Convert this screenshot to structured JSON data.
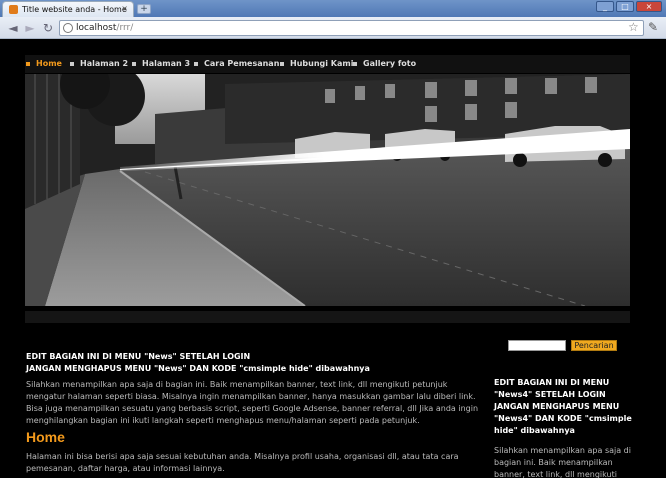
{
  "browser": {
    "tab_title": "Title website anda - Home",
    "tab_close": "×",
    "new_tab": "+",
    "url_host": "localhost",
    "url_path": "/rrr/",
    "win_min": "_",
    "win_max": "□",
    "win_close": "×",
    "icons": {
      "back": "◄",
      "forward": "►",
      "reload": "↻",
      "star": "☆",
      "wrench": "✎"
    }
  },
  "menu": {
    "items": [
      {
        "label": "Home",
        "active": true
      },
      {
        "label": "Halaman 2",
        "active": false
      },
      {
        "label": "Halaman 3",
        "active": false
      },
      {
        "label": "Cara Pemesanan",
        "active": false
      },
      {
        "label": "Hubungi Kami",
        "active": false
      },
      {
        "label": "Gallery foto",
        "active": false
      }
    ]
  },
  "search": {
    "placeholder": "",
    "button_label": "Pencarian"
  },
  "main": {
    "notice_line1": "EDIT BAGIAN INI DI MENU \"News\" SETELAH LOGIN",
    "notice_line2": "JANGAN MENGHAPUS MENU \"News\" DAN KODE \"cmsimple hide\" dibawahnya",
    "intro": "Silahkan menampilkan apa saja di bagian ini. Baik menampilkan banner, text link, dll mengikuti petunjuk mengatur halaman seperti biasa. Misalnya ingin menampilkan banner, hanya masukkan gambar lalu diberi link. Bisa juga menampilkan sesuatu yang berbasis script, seperti Google Adsense, banner referral, dll Jika anda ingin menghilangkan bagian ini ikuti langkah seperti menghapus menu/halaman seperti pada petunjuk.",
    "heading": "Home",
    "home_text": "Halaman ini bisa berisi apa saja sesuai kebutuhan anda. Misalnya profil usaha, organisasi dll, atau tata cara pemesanan, daftar harga, atau informasi lainnya."
  },
  "sidebar": {
    "notice_line1": "EDIT BAGIAN INI DI MENU \"News4\" SETELAH LOGIN",
    "notice_line2": "JANGAN MENGHAPUS MENU \"News4\" DAN KODE \"cmsimple hide\" dibawahnya",
    "text": "Silahkan menampilkan apa saja di bagian ini. Baik menampilkan banner, text link, dll mengikuti"
  },
  "colors": {
    "accent": "#f39a1c",
    "page_bg": "#000000"
  }
}
